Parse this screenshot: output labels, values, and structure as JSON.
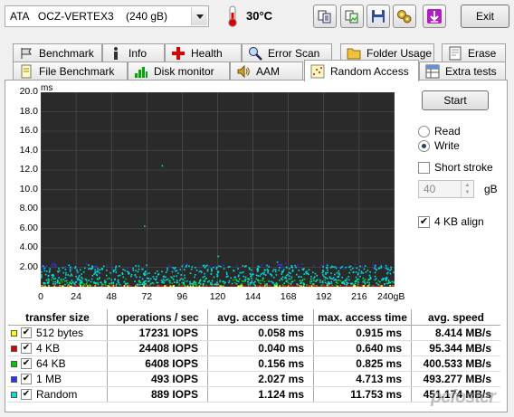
{
  "toolbar": {
    "drive": "ATA   OCZ-VERTEX3    (240 gB)",
    "temperature": "30°C",
    "exit_label": "Exit"
  },
  "tabs_row1": [
    {
      "label": "Benchmark",
      "icon": "benchmark-icon"
    },
    {
      "label": "Info",
      "icon": "info-icon"
    },
    {
      "label": "Health",
      "icon": "health-icon"
    },
    {
      "label": "Error Scan",
      "icon": "search-icon"
    },
    {
      "label": "Folder Usage",
      "icon": "folder-icon"
    },
    {
      "label": "Erase",
      "icon": "erase-icon"
    }
  ],
  "tabs_row2": [
    {
      "label": "File Benchmark",
      "icon": "file-icon"
    },
    {
      "label": "Disk monitor",
      "icon": "monitor-icon"
    },
    {
      "label": "AAM",
      "icon": "speaker-icon"
    },
    {
      "label": "Random Access",
      "icon": "dots-icon",
      "active": true
    },
    {
      "label": "Extra tests",
      "icon": "tests-icon"
    }
  ],
  "controls": {
    "start_label": "Start",
    "read_label": "Read",
    "write_label": "Write",
    "mode": "Write",
    "short_stroke_label": "Short stroke",
    "short_stroke_checked": false,
    "stroke_value": "40",
    "stroke_unit": "gB",
    "align_label": "4 KB align",
    "align_checked": true
  },
  "chart_data": {
    "type": "scatter",
    "ylabel": "ms",
    "y_ticks": [
      "20.0",
      "18.0",
      "16.0",
      "14.0",
      "12.0",
      "10.0",
      "8.00",
      "6.00",
      "4.00",
      "2.00"
    ],
    "x_ticks": [
      "0",
      "24",
      "48",
      "72",
      "96",
      "120",
      "144",
      "168",
      "192",
      "216",
      "240gB"
    ],
    "xlim": [
      0,
      240
    ],
    "ylim": [
      0,
      20
    ],
    "grid": true,
    "background": "#2a2a2a",
    "series": [
      {
        "name": "512 bytes",
        "color": "#ffff00",
        "band": [
          0.03,
          0.09
        ]
      },
      {
        "name": "4 KB",
        "color": "#e00000",
        "band": [
          0.03,
          0.06
        ]
      },
      {
        "name": "64 KB",
        "color": "#00c800",
        "band": [
          0.12,
          0.8
        ]
      },
      {
        "name": "1 MB",
        "color": "#3030ff",
        "band": [
          1.8,
          2.4
        ]
      },
      {
        "name": "Random",
        "color": "#00e0e0",
        "band": [
          0.2,
          2.2
        ]
      }
    ]
  },
  "table": {
    "headers": [
      "transfer size",
      "operations / sec",
      "avg. access time",
      "max. access time",
      "avg. speed"
    ],
    "rows": [
      {
        "label": "512 bytes",
        "color": "#ffff00",
        "ops": "17231 IOPS",
        "avg": "0.058 ms",
        "max": "0.915 ms",
        "speed": "8.414 MB/s"
      },
      {
        "label": "4 KB",
        "color": "#e00000",
        "ops": "24408 IOPS",
        "avg": "0.040 ms",
        "max": "0.640 ms",
        "speed": "95.344 MB/s"
      },
      {
        "label": "64 KB",
        "color": "#00c800",
        "ops": "6408 IOPS",
        "avg": "0.156 ms",
        "max": "0.825 ms",
        "speed": "400.533 MB/s"
      },
      {
        "label": "1 MB",
        "color": "#3030ff",
        "ops": "493 IOPS",
        "avg": "2.027 ms",
        "max": "4.713 ms",
        "speed": "493.277 MB/s"
      },
      {
        "label": "Random",
        "color": "#00e0e0",
        "ops": "889 IOPS",
        "avg": "1.124 ms",
        "max": "11.753 ms",
        "speed": "451.174 MB/s"
      }
    ]
  },
  "watermark": "pcfoster"
}
